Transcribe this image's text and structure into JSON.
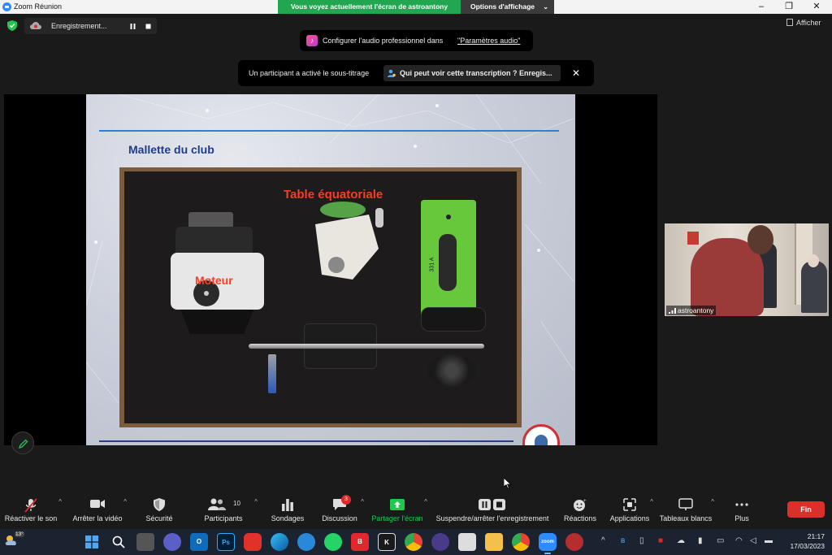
{
  "window": {
    "title": "Zoom Réunion",
    "share_banner": "Vous voyez actuellement l'écran de astroantony",
    "view_options": "Options d'affichage"
  },
  "recording": {
    "label": "Enregistrement..."
  },
  "afficher": "Afficher",
  "audio_note": {
    "text": "Configurer l'audio professionnel dans",
    "link": "\"Paramètres audio\""
  },
  "cc_note": {
    "text": "Un participant a activé le sous-titrage",
    "button": "Qui peut voir cette transcription ? Enregis..."
  },
  "slide": {
    "title": "Mallette du club",
    "label_table": "Table équatoriale",
    "label_moteur": "Moteur",
    "plate_label": "331 A"
  },
  "thumbnail": {
    "name": "astroantony"
  },
  "toolbar": {
    "unmute": "Réactiver le son",
    "stop_video": "Arrêter la vidéo",
    "security": "Sécurité",
    "participants": "Participants",
    "participants_count": "10",
    "polls": "Sondages",
    "chat": "Discussion",
    "chat_badge": "3",
    "share": "Partager l'écran",
    "recording": "Suspendre/arrêter l'enregistrement",
    "reactions": "Réactions",
    "apps": "Applications",
    "whiteboards": "Tableaux blancs",
    "more": "Plus",
    "end": "Fin"
  },
  "taskbar": {
    "weather_temp": "13°",
    "clock_time": "21:17",
    "clock_date": "17/03/2023",
    "apps": [
      "windows-start",
      "search",
      "task-view",
      "teams",
      "outlook",
      "photoshop",
      "brave",
      "edge",
      "cloud-app",
      "whatsapp",
      "bitdefender",
      "kodak",
      "chrome",
      "astro-app",
      "snip",
      "files",
      "chrome-profile",
      "zoom",
      "game"
    ]
  },
  "colors": {
    "accent_green": "#23a650",
    "end_red": "#d9302c",
    "zoom_blue": "#2d8cff",
    "slide_title_blue": "#1f3c8c",
    "label_red": "#ff3b1f"
  }
}
